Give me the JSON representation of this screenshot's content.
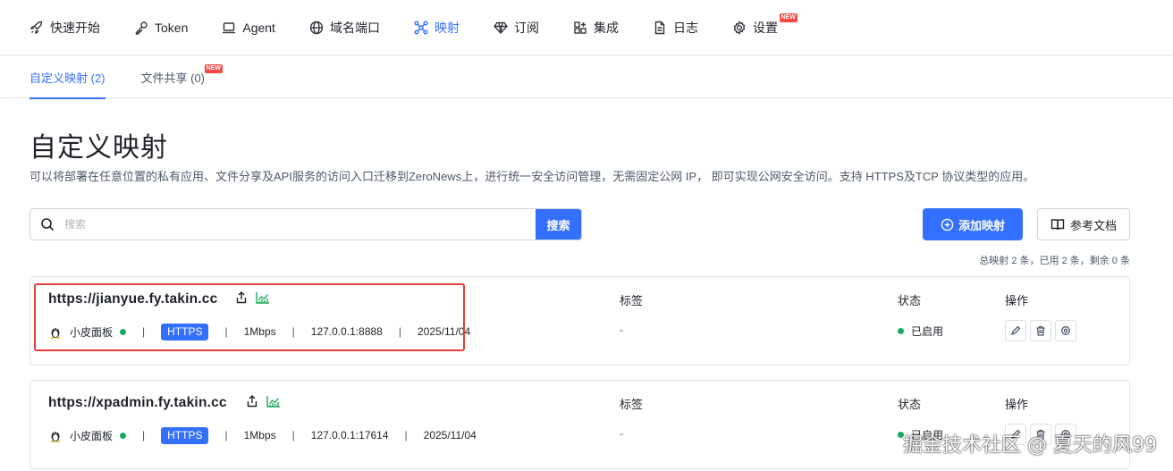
{
  "nav": {
    "items": [
      {
        "label": "快速开始",
        "icon": "rocket-icon"
      },
      {
        "label": "Token",
        "icon": "key-icon"
      },
      {
        "label": "Agent",
        "icon": "laptop-icon"
      },
      {
        "label": "域名端口",
        "icon": "globe-icon"
      },
      {
        "label": "映射",
        "icon": "network-icon",
        "active": true
      },
      {
        "label": "订阅",
        "icon": "diamond-icon"
      },
      {
        "label": "集成",
        "icon": "grid-plus-icon"
      },
      {
        "label": "日志",
        "icon": "document-icon"
      },
      {
        "label": "设置",
        "icon": "gear-icon",
        "badge": "NEW"
      }
    ]
  },
  "subtabs": [
    {
      "label": "自定义映射 (2)",
      "active": true
    },
    {
      "label": "文件共享 (0)",
      "badge": "NEW"
    }
  ],
  "page": {
    "title": "自定义映射",
    "description": "可以将部署在任意位置的私有应用、文件分享及API服务的访问入口迁移到ZeroNews上，进行统一安全访问管理，无需固定公网 IP， 即可实现公网安全访问。支持 HTTPS及TCP 协议类型的应用。"
  },
  "search": {
    "placeholder": "搜索",
    "value": "",
    "button_label": "搜索"
  },
  "actions": {
    "add_label": "添加映射",
    "docs_label": "参考文档"
  },
  "summary": "总映射 2 条，已用 2 条，剩余 0 条",
  "columns": {
    "tags": "标签",
    "status": "状态",
    "ops": "操作"
  },
  "mappings": [
    {
      "url": "https://jianyue.fy.takin.cc",
      "agent": "小皮面板",
      "protocol": "HTTPS",
      "bandwidth": "1Mbps",
      "target": "127.0.0.1:8888",
      "date": "2025/11/04",
      "tags": "-",
      "status": "已启用"
    },
    {
      "url": "https://xpadmin.fy.takin.cc",
      "agent": "小皮面板",
      "protocol": "HTTPS",
      "bandwidth": "1Mbps",
      "target": "127.0.0.1:17614",
      "date": "2025/11/04",
      "tags": "-",
      "status": "已启用"
    }
  ],
  "watermark": "掘金技术社区 @ 夏天的风99",
  "colors": {
    "accent": "#3370ff",
    "success": "#1aab5e",
    "highlight": "#e0413b",
    "badge": "#f54a45"
  }
}
